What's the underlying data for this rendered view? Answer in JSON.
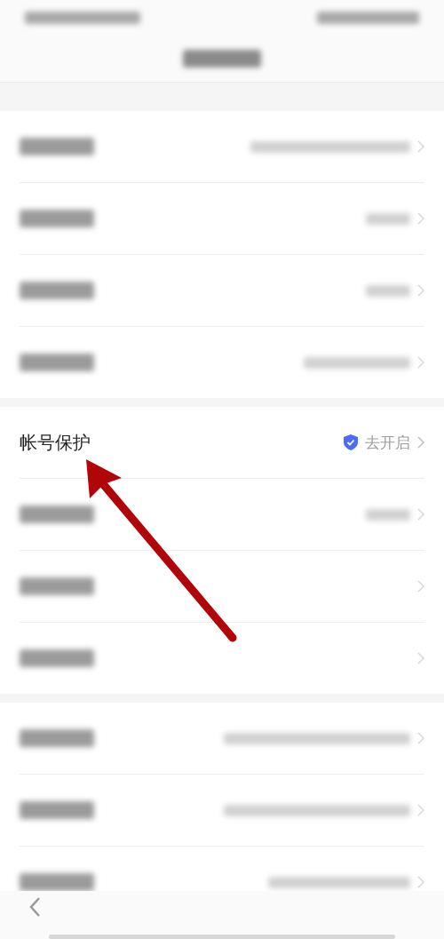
{
  "groups": [
    {
      "rows": [
        {
          "kind": "blurred",
          "has_value": true
        },
        {
          "kind": "blurred",
          "has_value": true
        },
        {
          "kind": "blurred",
          "has_value": true
        },
        {
          "kind": "blurred",
          "has_value": true
        }
      ]
    },
    {
      "rows": [
        {
          "kind": "text",
          "label": "帐号保护",
          "value": "去开启",
          "shield": true
        },
        {
          "kind": "blurred",
          "has_value": true
        },
        {
          "kind": "blurred",
          "has_value": false
        },
        {
          "kind": "blurred",
          "has_value": false
        }
      ]
    },
    {
      "rows": [
        {
          "kind": "blurred",
          "has_value": true
        },
        {
          "kind": "blurred",
          "has_value": true
        },
        {
          "kind": "blurred",
          "has_value": true
        }
      ]
    }
  ],
  "annotation": {
    "kind": "arrow"
  }
}
